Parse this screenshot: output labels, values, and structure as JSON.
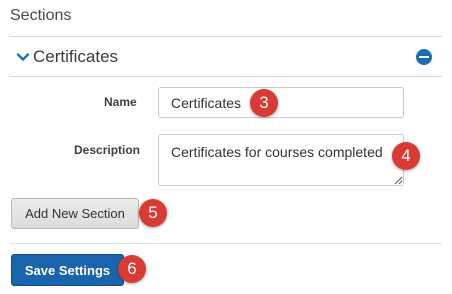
{
  "header": {
    "title": "Sections"
  },
  "section": {
    "name": "Certificates",
    "chevron_icon": "chevron-down-icon",
    "collapse_icon": "minus-circle-icon",
    "accent_color": "#1b6db7"
  },
  "form": {
    "name_label": "Name",
    "name_value": "Certificates",
    "description_label": "Description",
    "description_value": "Certificates for courses completed"
  },
  "buttons": {
    "add_section": "Add New Section",
    "save_settings": "Save Settings"
  },
  "callouts": {
    "name": "3",
    "description": "4",
    "add_section": "5",
    "save_settings": "6",
    "color": "#d93a34"
  }
}
